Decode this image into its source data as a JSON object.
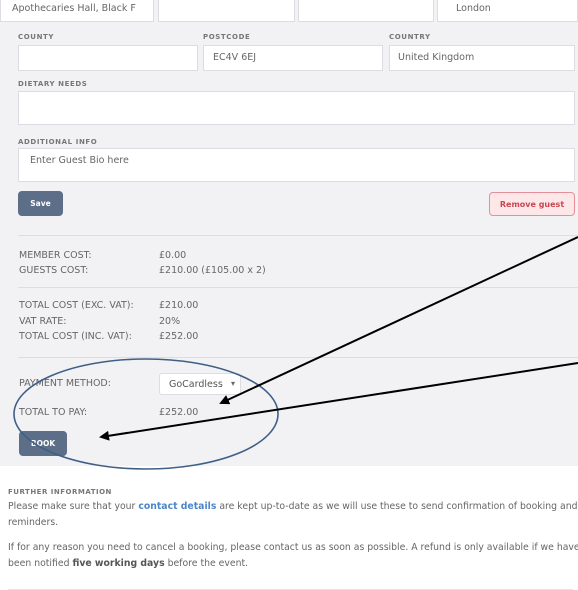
{
  "address": {
    "address_line_value": "Apothecaries Hall, Black F",
    "field2_value": "",
    "field3_value": "",
    "city_value": "London"
  },
  "labels": {
    "county": "COUNTY",
    "postcode": "POSTCODE",
    "country": "COUNTRY",
    "dietary_needs": "DIETARY NEEDS",
    "additional_info": "ADDITIONAL INFO"
  },
  "fields": {
    "county_value": "",
    "postcode_value": "EC4V 6EJ",
    "country_value": "United Kingdom",
    "dietary_needs_value": "",
    "additional_info_placeholder": "Enter Guest Bio here"
  },
  "buttons": {
    "save": "Save",
    "remove_guest": "Remove guest",
    "book": "BOOK"
  },
  "costs": {
    "member_cost_label": "MEMBER COST:",
    "member_cost_value": "£0.00",
    "guests_cost_label": "GUESTS COST:",
    "guests_cost_value": "£210.00 (£105.00 x 2)",
    "total_exc_label": "TOTAL COST (EXC. VAT):",
    "total_exc_value": "£210.00",
    "vat_rate_label": "VAT RATE:",
    "vat_rate_value": "20%",
    "total_inc_label": "TOTAL COST (INC. VAT):",
    "total_inc_value": "£252.00",
    "payment_method_label": "PAYMENT METHOD:",
    "payment_method_value": "GoCardless",
    "total_to_pay_label": "TOTAL TO PAY:",
    "total_to_pay_value": "£252.00"
  },
  "further_info": {
    "heading": "FURTHER INFORMATION",
    "p1_start": "Please make sure that your ",
    "p1_link": "contact details",
    "p1_end": " are kept up-to-date as we will use these to send confirmation of booking and reminders.",
    "p2_start": "If for any reason you need to cancel a booking, please contact us as soon as possible. A refund is only available if we have been notified ",
    "p2_bold": "five working days",
    "p2_end": " before the event."
  },
  "colors": {
    "panel_bg": "#f2f2f4",
    "primary_button": "#5c6e88",
    "danger_text": "#c8464f",
    "link": "#4d86c8",
    "annotation_circle": "#3f5f87",
    "annotation_arrow": "#000000"
  },
  "icons": {
    "select_caret": "chevron-down-icon",
    "annotations": "arrow-icon"
  }
}
